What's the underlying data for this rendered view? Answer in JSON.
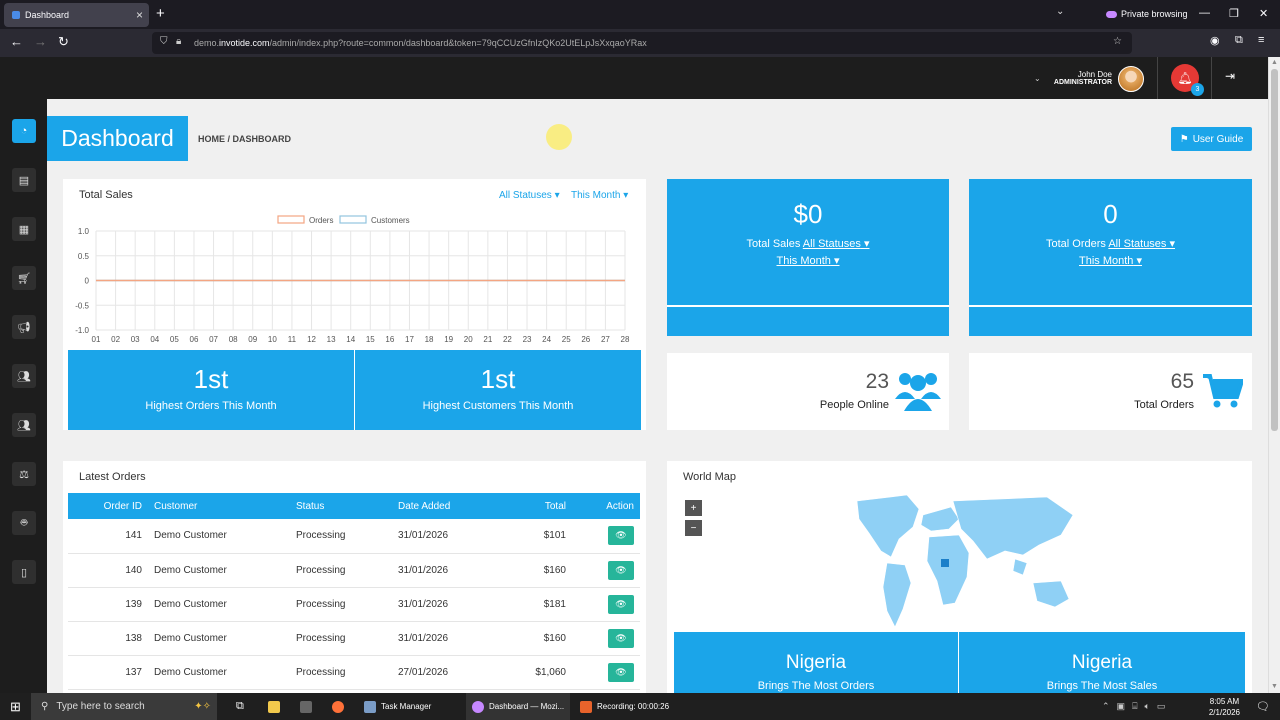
{
  "browser": {
    "tab_title": "Dashboard",
    "private_label": "Private browsing",
    "url_prefix": "demo.",
    "url_domain": "invotide.com",
    "url_path": "/admin/index.php?route=common/dashboard&token=79qCCUzGfnIzQKo2UtELpJsXxqaoYRax"
  },
  "header": {
    "user_name": "John Doe",
    "user_role": "ADMINISTRATOR",
    "notification_count": "3"
  },
  "page": {
    "title": "Dashboard",
    "breadcrumb": "HOME / DASHBOARD",
    "user_guide": "User Guide"
  },
  "total_sales_chart": {
    "title": "Total Sales",
    "filter_status": "All Statuses",
    "filter_period": "This Month"
  },
  "chart_data": {
    "type": "line",
    "title": "Total Sales",
    "x": [
      "01",
      "02",
      "03",
      "04",
      "05",
      "06",
      "07",
      "08",
      "09",
      "10",
      "11",
      "12",
      "13",
      "14",
      "15",
      "16",
      "17",
      "18",
      "19",
      "20",
      "21",
      "22",
      "23",
      "24",
      "25",
      "26",
      "27",
      "28"
    ],
    "series": [
      {
        "name": "Orders",
        "values": [
          0,
          0,
          0,
          0,
          0,
          0,
          0,
          0,
          0,
          0,
          0,
          0,
          0,
          0,
          0,
          0,
          0,
          0,
          0,
          0,
          0,
          0,
          0,
          0,
          0,
          0,
          0,
          0
        ]
      },
      {
        "name": "Customers",
        "values": [
          0,
          0,
          0,
          0,
          0,
          0,
          0,
          0,
          0,
          0,
          0,
          0,
          0,
          0,
          0,
          0,
          0,
          0,
          0,
          0,
          0,
          0,
          0,
          0,
          0,
          0,
          0,
          0
        ]
      }
    ],
    "yticks": [
      "1.0",
      "0.5",
      "0",
      "-0.5",
      "-1.0"
    ],
    "ylim": [
      -1,
      1
    ],
    "grid": true,
    "legend": "top-center",
    "colors": {
      "Orders": "#f4a582",
      "Customers": "#92c5de"
    }
  },
  "highlights": {
    "orders_rank": "1st",
    "orders_label": "Highest Orders This Month",
    "customers_rank": "1st",
    "customers_label": "Highest Customers This Month"
  },
  "stats": {
    "total_sales_value": "$0",
    "total_sales_label": "Total Sales",
    "total_sales_status": "All Statuses",
    "total_sales_period": "This Month",
    "total_orders_value": "0",
    "total_orders_label": "Total Orders",
    "total_orders_status": "All Statuses",
    "total_orders_period": "This Month",
    "people_online_value": "23",
    "people_online_label": "People Online",
    "total_orders_count": "65",
    "total_orders_count_label": "Total Orders"
  },
  "latest_orders": {
    "title": "Latest Orders",
    "columns": [
      "Order ID",
      "Customer",
      "Status",
      "Date Added",
      "Total",
      "Action"
    ],
    "rows": [
      {
        "id": "141",
        "customer": "Demo Customer",
        "status": "Processing",
        "date": "31/01/2026",
        "total": "$101"
      },
      {
        "id": "140",
        "customer": "Demo Customer",
        "status": "Processing",
        "date": "31/01/2026",
        "total": "$160"
      },
      {
        "id": "139",
        "customer": "Demo Customer",
        "status": "Processing",
        "date": "31/01/2026",
        "total": "$181"
      },
      {
        "id": "138",
        "customer": "Demo Customer",
        "status": "Processing",
        "date": "31/01/2026",
        "total": "$160"
      },
      {
        "id": "137",
        "customer": "Demo Customer",
        "status": "Processing",
        "date": "27/01/2026",
        "total": "$1,060"
      }
    ]
  },
  "world_map": {
    "title": "World Map",
    "zoom_in": "+",
    "zoom_out": "−",
    "most_orders_country": "Nigeria",
    "most_orders_label": "Brings The Most Orders",
    "most_sales_country": "Nigeria",
    "most_sales_label": "Brings The Most Sales"
  },
  "taskbar": {
    "search_placeholder": "Type here to search",
    "task_manager": "Task Manager",
    "firefox_window": "Dashboard — Mozi...",
    "recording": "Recording:  00:00:26",
    "time": "8:05 AM",
    "date": "2/1/2026"
  },
  "colors": {
    "accent": "#1ba5e9",
    "view_button": "#26b59a",
    "bell": "#e53935"
  }
}
